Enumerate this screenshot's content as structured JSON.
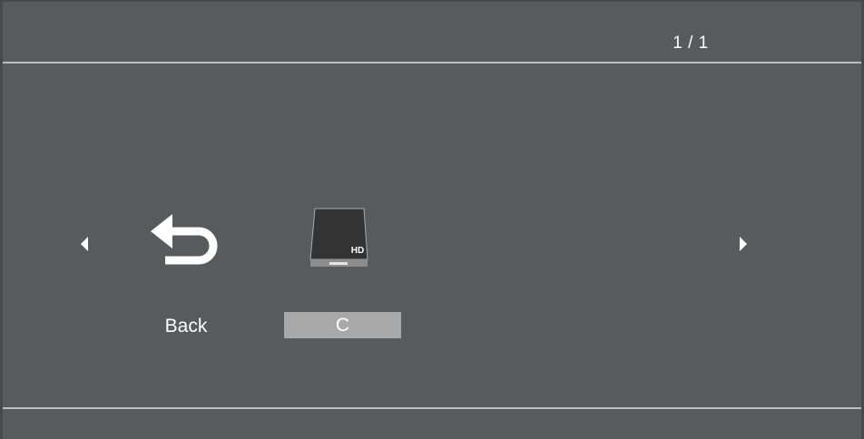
{
  "header": {
    "page_indicator": "1 / 1"
  },
  "items": [
    {
      "label": "Back",
      "icon": "back-arrow-icon",
      "selected": false
    },
    {
      "label": "C",
      "icon": "hard-drive-icon",
      "icon_text": "HD",
      "selected": true
    }
  ],
  "navigation": {
    "prev_icon": "triangle-left-icon",
    "next_icon": "triangle-right-icon"
  },
  "colors": {
    "background": "#595a5c",
    "divider": "#bfbfbf",
    "selection": "#a9a9aa",
    "text": "#ffffff"
  }
}
